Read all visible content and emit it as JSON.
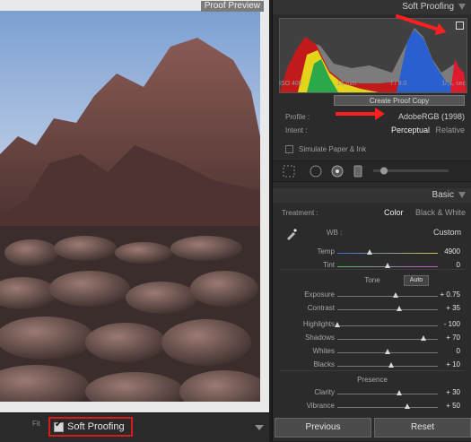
{
  "preview": {
    "label": "Proof Preview",
    "fit_label": "Fit"
  },
  "bottom": {
    "soft_proofing_label": "Soft Proofing"
  },
  "header": {
    "panel_title": "Soft Proofing",
    "basic_title": "Basic"
  },
  "histogram": {
    "iso": "ISO 400",
    "focal": "16 mm",
    "aperture": "f / 9.0",
    "shutter": "1/₁₄₀ sec"
  },
  "proofing": {
    "create_proof_copy": "Create Proof Copy",
    "profile_label": "Profile :",
    "profile_value": "AdobeRGB (1998)",
    "intent_label": "Intent :",
    "intent_perceptual": "Perceptual",
    "intent_relative": "Relative",
    "simulate_label": "Simulate Paper & Ink"
  },
  "basic": {
    "treatment_label": "Treatment :",
    "treatment_color": "Color",
    "treatment_bw": "Black & White",
    "wb_label": "WB :",
    "wb_value": "Custom",
    "tone_title": "Tone",
    "auto": "Auto",
    "presence_title": "Presence",
    "sliders": [
      {
        "label": "Temp",
        "value": "4900",
        "fraction": 0.32
      },
      {
        "label": "Tint",
        "value": "0",
        "fraction": 0.5
      },
      {
        "label": "Exposure",
        "value": "+ 0.75",
        "fraction": 0.58
      },
      {
        "label": "Contrast",
        "value": "+ 35",
        "fraction": 0.62
      },
      {
        "label": "Highlights",
        "value": "- 100",
        "fraction": 0.0
      },
      {
        "label": "Shadows",
        "value": "+ 70",
        "fraction": 0.86
      },
      {
        "label": "Whites",
        "value": "0",
        "fraction": 0.5
      },
      {
        "label": "Blacks",
        "value": "+ 10",
        "fraction": 0.54
      },
      {
        "label": "Clarity",
        "value": "+ 30",
        "fraction": 0.62
      },
      {
        "label": "Vibrance",
        "value": "+ 50",
        "fraction": 0.7
      }
    ]
  },
  "footer": {
    "previous": "Previous",
    "reset": "Reset"
  },
  "colors": {
    "accent_red": "#ff1f1f",
    "highlight_box": "#d61d1d"
  }
}
